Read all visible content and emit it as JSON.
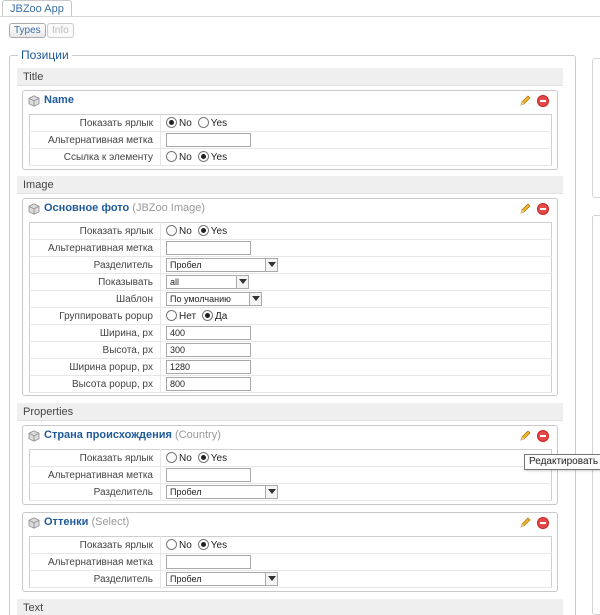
{
  "app": {
    "tab_title": "JBZoo App"
  },
  "toolbar": {
    "types_label": "Types",
    "info_label": "Info"
  },
  "panel": {
    "legend": "Позиции"
  },
  "tooltip": "Редактировать по",
  "sections": [
    {
      "title": "Title"
    },
    {
      "title": "Image"
    },
    {
      "title": "Properties"
    },
    {
      "title": "Text"
    }
  ],
  "elements": [
    {
      "name": "Name",
      "type": "",
      "rows": [
        {
          "label": "Показать ярлык",
          "kind": "radio",
          "options": [
            "No",
            "Yes"
          ],
          "selected": 0
        },
        {
          "label": "Альтернативная метка",
          "kind": "input",
          "value": ""
        },
        {
          "label": "Ссылка к элементу",
          "kind": "radio",
          "options": [
            "No",
            "Yes"
          ],
          "selected": 1
        }
      ]
    },
    {
      "name": "Основное фото",
      "type": "(JBZoo Image)",
      "rows": [
        {
          "label": "Показать ярлык",
          "kind": "radio",
          "options": [
            "No",
            "Yes"
          ],
          "selected": 1
        },
        {
          "label": "Альтернативная метка",
          "kind": "input",
          "value": ""
        },
        {
          "label": "Разделитель",
          "kind": "select",
          "value": "Пробел"
        },
        {
          "label": "Показывать",
          "kind": "select",
          "value": "all"
        },
        {
          "label": "Шаблон",
          "kind": "select",
          "value": "По умолчанию"
        },
        {
          "label": "Группировать popup",
          "kind": "radio",
          "options": [
            "Нет",
            "Да"
          ],
          "selected": 1
        },
        {
          "label": "Ширина, px",
          "kind": "input",
          "value": "400"
        },
        {
          "label": "Высота, px",
          "kind": "input",
          "value": "300"
        },
        {
          "label": "Ширина popup, px",
          "kind": "input",
          "value": "1280"
        },
        {
          "label": "Высота popup, px",
          "kind": "input",
          "value": "800"
        }
      ]
    },
    {
      "name": "Страна происхождения",
      "type": "(Country)",
      "rows": [
        {
          "label": "Показать ярлык",
          "kind": "radio",
          "options": [
            "No",
            "Yes"
          ],
          "selected": 1
        },
        {
          "label": "Альтернативная метка",
          "kind": "input",
          "value": ""
        },
        {
          "label": "Разделитель",
          "kind": "select",
          "value": "Пробел"
        }
      ]
    },
    {
      "name": "Оттенки",
      "type": "(Select)",
      "rows": [
        {
          "label": "Показать ярлык",
          "kind": "radio",
          "options": [
            "No",
            "Yes"
          ],
          "selected": 1
        },
        {
          "label": "Альтернативная метка",
          "kind": "input",
          "value": ""
        },
        {
          "label": "Разделитель",
          "kind": "select",
          "value": "Пробел"
        }
      ]
    }
  ]
}
